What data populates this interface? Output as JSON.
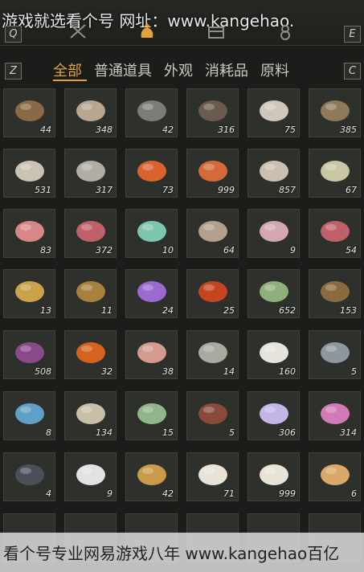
{
  "watermark_top": "游戏就选看个号  网址：www.kangehao.",
  "watermark_bottom": "看个号专业网易游戏八年  www.kangehao百亿",
  "keys": {
    "left_top": "Q",
    "right_top": "E",
    "left_filter": "Z",
    "right_filter": "C"
  },
  "filters": [
    "全部",
    "普通道具",
    "外观",
    "消耗品",
    "原料"
  ],
  "active_filter": 0,
  "items": [
    {
      "qty": "44",
      "color": "#8a6a46",
      "icon": "bark-icon"
    },
    {
      "qty": "348",
      "color": "#b9a690",
      "icon": "wood-icon"
    },
    {
      "qty": "42",
      "color": "#7d7c78",
      "icon": "stone-icon"
    },
    {
      "qty": "316",
      "color": "#6a5b4e",
      "icon": "feather-icon"
    },
    {
      "qty": "75",
      "color": "#cfc7bb",
      "icon": "mushroom-icon"
    },
    {
      "qty": "385",
      "color": "#8e7a5a",
      "icon": "cricket-icon"
    },
    {
      "qty": "531",
      "color": "#cbc2b4",
      "icon": "sack-icon"
    },
    {
      "qty": "317",
      "color": "#b2aea4",
      "icon": "fish-icon"
    },
    {
      "qty": "73",
      "color": "#d9622e",
      "icon": "berry-icon"
    },
    {
      "qty": "999",
      "color": "#d46a3a",
      "icon": "berry-icon"
    },
    {
      "qty": "857",
      "color": "#cdbfae",
      "icon": "mushroom-icon"
    },
    {
      "qty": "67",
      "color": "#c8c6a3",
      "icon": "eggs-icon"
    },
    {
      "qty": "83",
      "color": "#d98686",
      "icon": "meat-icon"
    },
    {
      "qty": "372",
      "color": "#c0616a",
      "icon": "steak-icon"
    },
    {
      "qty": "10",
      "color": "#7fc6b0",
      "icon": "jade-icon"
    },
    {
      "qty": "64",
      "color": "#b29f8c",
      "icon": "hide-icon"
    },
    {
      "qty": "9",
      "color": "#d2a6b3",
      "icon": "intestine-icon"
    },
    {
      "qty": "54",
      "color": "#c0616a",
      "icon": "steak-icon"
    },
    {
      "qty": "13",
      "color": "#c9a24a",
      "icon": "carp-icon"
    },
    {
      "qty": "11",
      "color": "#a8823c",
      "icon": "ore-icon"
    },
    {
      "qty": "24",
      "color": "#9b6ad0",
      "icon": "crystal-icon"
    },
    {
      "qty": "25",
      "color": "#c4451f",
      "icon": "gem-icon"
    },
    {
      "qty": "652",
      "color": "#8fb07b",
      "icon": "herb-icon"
    },
    {
      "qty": "153",
      "color": "#8a6a3e",
      "icon": "bowl-icon"
    },
    {
      "qty": "508",
      "color": "#8a4a8a",
      "icon": "flower-icon"
    },
    {
      "qty": "32",
      "color": "#d4631f",
      "icon": "flower-icon"
    },
    {
      "qty": "38",
      "color": "#d39b8e",
      "icon": "meat-icon"
    },
    {
      "qty": "14",
      "color": "#a9a9a0",
      "icon": "needles-icon"
    },
    {
      "qty": "160",
      "color": "#e6e3dc",
      "icon": "fur-icon"
    },
    {
      "qty": "5",
      "color": "#8e96a0",
      "icon": "rock-icon"
    },
    {
      "qty": "8",
      "color": "#5fa0c8",
      "icon": "ore-icon"
    },
    {
      "qty": "134",
      "color": "#c9bfa9",
      "icon": "bone-icon"
    },
    {
      "qty": "15",
      "color": "#8fb78a",
      "icon": "egg-icon"
    },
    {
      "qty": "5",
      "color": "#8a4a3a",
      "icon": "twig-icon"
    },
    {
      "qty": "306",
      "color": "#c3b6e6",
      "icon": "flower-icon"
    },
    {
      "qty": "314",
      "color": "#d27ab8",
      "icon": "flower-icon"
    },
    {
      "qty": "4",
      "color": "#4a5058",
      "icon": "feather-icon"
    },
    {
      "qty": "9",
      "color": "#e2e2e2",
      "icon": "tail-icon"
    },
    {
      "qty": "42",
      "color": "#c99a4a",
      "icon": "shell-icon"
    },
    {
      "qty": "71",
      "color": "#e8e3d6",
      "icon": "milk-bowl-icon"
    },
    {
      "qty": "999",
      "color": "#e8e3d6",
      "icon": "milk-bowl-icon"
    },
    {
      "qty": "6",
      "color": "#d9a86a",
      "icon": "food-icon"
    }
  ]
}
